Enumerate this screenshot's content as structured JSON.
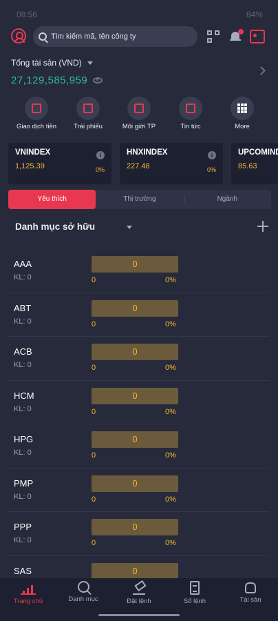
{
  "status_bar": {
    "time": "08:56",
    "battery": "84%"
  },
  "header": {
    "search_placeholder": "Tìm kiếm mã, tên công ty"
  },
  "assets": {
    "title": "Tổng tài sản (VND)",
    "value": "27,129,585,959"
  },
  "quick_actions": [
    {
      "label": "Giao dịch tiền",
      "icon": "money-transfer-icon"
    },
    {
      "label": "Trái phiếu",
      "icon": "bond-icon"
    },
    {
      "label": "Môi giới TP",
      "icon": "bond-broker-icon"
    },
    {
      "label": "Tin tức",
      "icon": "news-icon"
    },
    {
      "label": "More",
      "icon": "grid-icon"
    }
  ],
  "indices": [
    {
      "name": "VNINDEX",
      "value": "1,125.39",
      "change_pct": "0%"
    },
    {
      "name": "HNXINDEX",
      "value": "227.48",
      "change_pct": "0%"
    },
    {
      "name": "UPCOMINDEX",
      "value": "85.63",
      "change_pct": "0%"
    }
  ],
  "tabs": [
    {
      "label": "Yêu thích",
      "active": true
    },
    {
      "label": "Thị trường",
      "active": false
    },
    {
      "label": "Ngành",
      "active": false
    }
  ],
  "portfolio": {
    "title": "Danh mục sở hữu"
  },
  "stocks": [
    {
      "symbol": "AAA",
      "kl": "KL: 0",
      "price": "0",
      "change": "0",
      "change_pct": "0%"
    },
    {
      "symbol": "ABT",
      "kl": "KL: 0",
      "price": "0",
      "change": "0",
      "change_pct": "0%"
    },
    {
      "symbol": "ACB",
      "kl": "KL: 0",
      "price": "0",
      "change": "0",
      "change_pct": "0%"
    },
    {
      "symbol": "HCM",
      "kl": "KL: 0",
      "price": "0",
      "change": "0",
      "change_pct": "0%"
    },
    {
      "symbol": "HPG",
      "kl": "KL: 0",
      "price": "0",
      "change": "0",
      "change_pct": "0%"
    },
    {
      "symbol": "PMP",
      "kl": "KL: 0",
      "price": "0",
      "change": "0",
      "change_pct": "0%"
    },
    {
      "symbol": "PPP",
      "kl": "KL: 0",
      "price": "0",
      "change": "0",
      "change_pct": "0%"
    },
    {
      "symbol": "SAS",
      "kl": "",
      "price": "0",
      "change": "",
      "change_pct": ""
    }
  ],
  "bottom_nav": [
    {
      "label": "Trang chủ",
      "active": true
    },
    {
      "label": "Danh mục",
      "active": false
    },
    {
      "label": "Đặt lệnh",
      "active": false
    },
    {
      "label": "Sổ lệnh",
      "active": false
    },
    {
      "label": "Tài sản",
      "active": false
    }
  ],
  "colors": {
    "background": "#262a3b",
    "accent": "#e8384f",
    "price_yellow": "#f5b72c",
    "positive_green": "#2ec08c"
  }
}
